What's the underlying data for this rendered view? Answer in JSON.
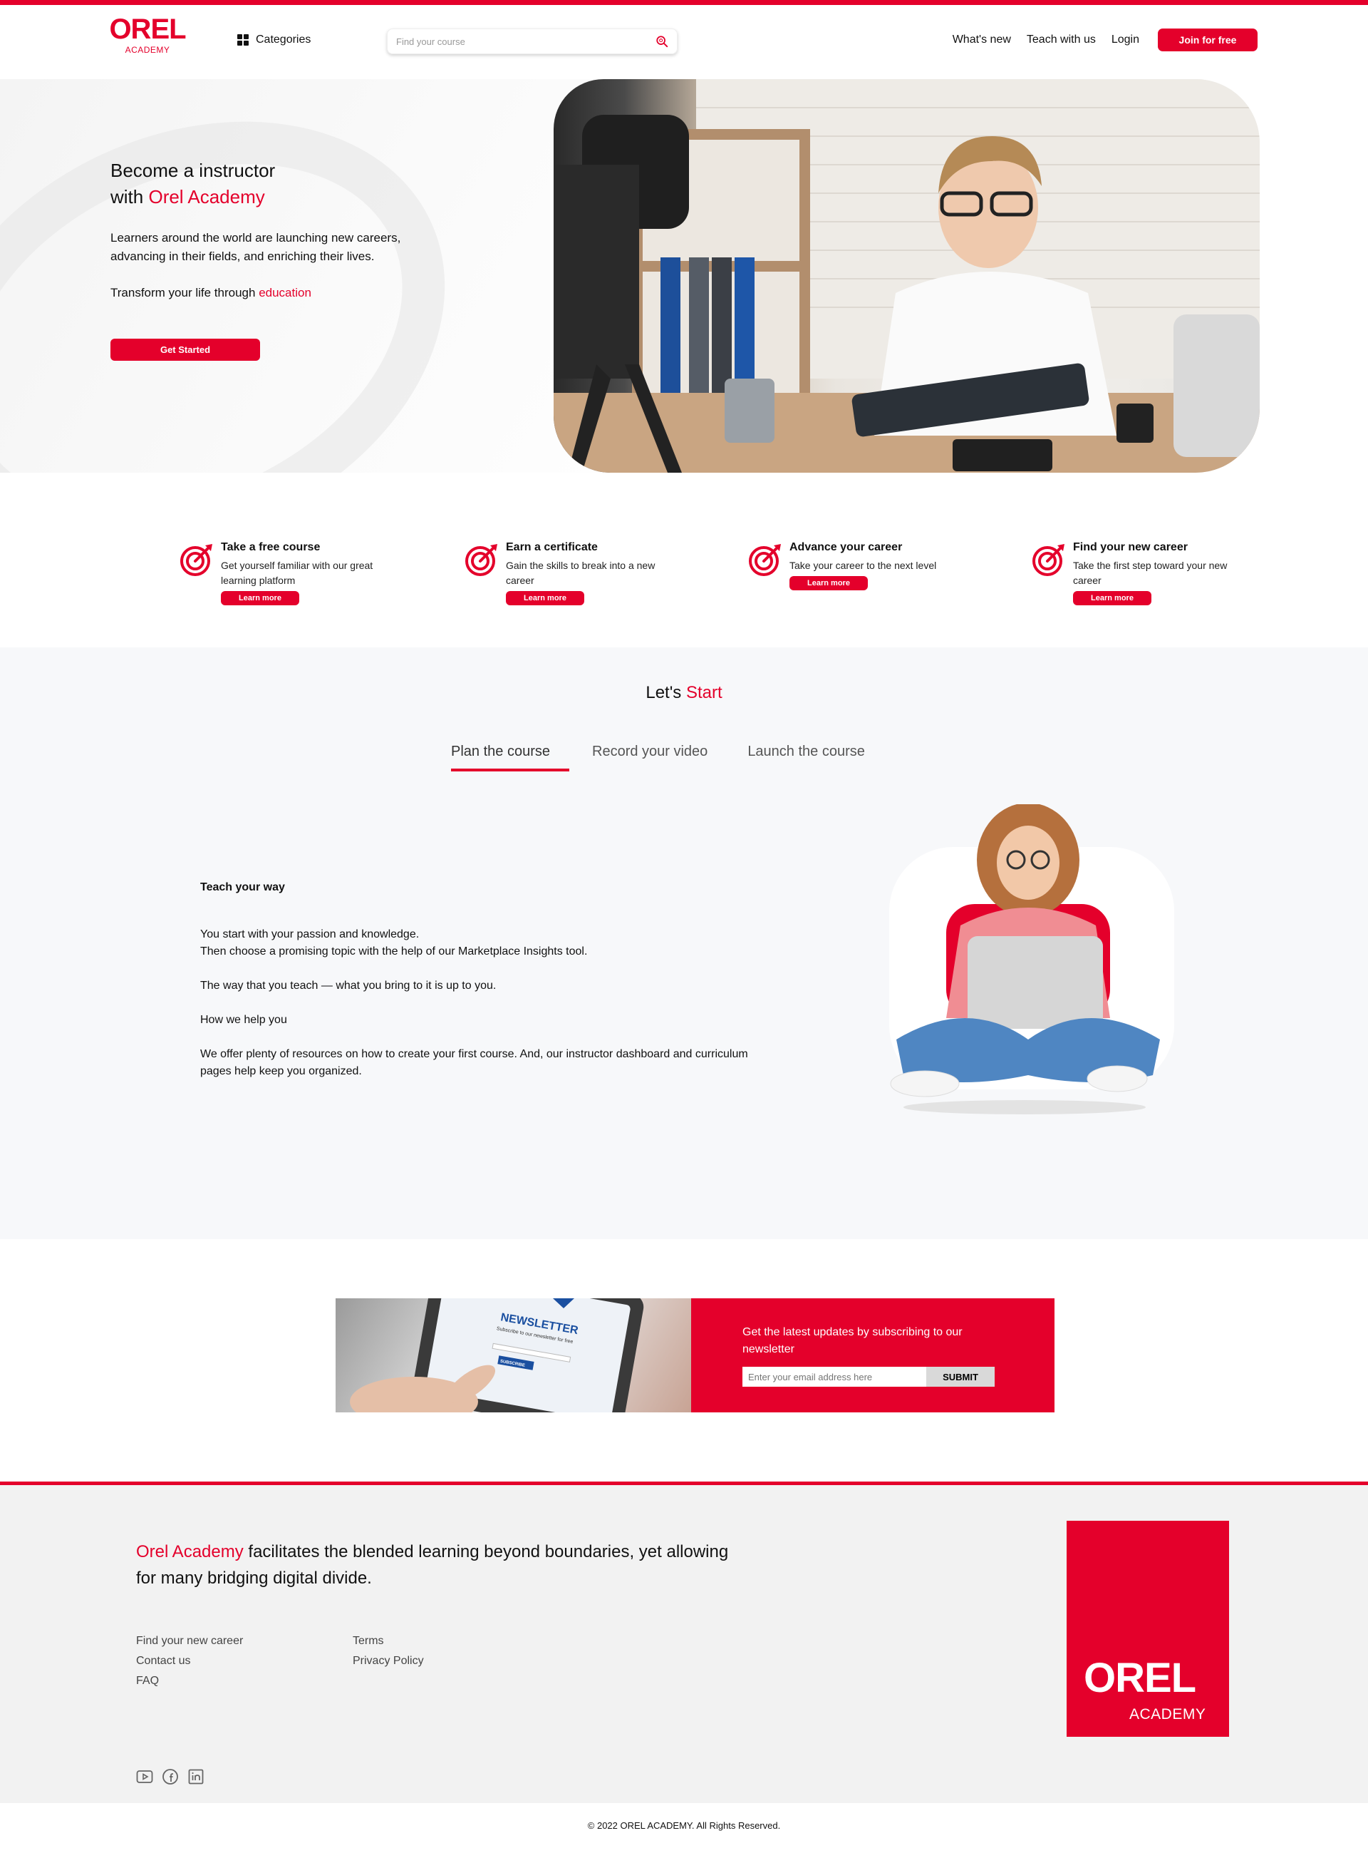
{
  "brand": {
    "logo_main": "OREL",
    "logo_sub": "ACADEMY",
    "accent_color": "#e4002b"
  },
  "header": {
    "categories_label": "Categories",
    "search_placeholder": "Find your course",
    "nav": {
      "whats_new": "What's new",
      "teach": "Teach with us",
      "login": "Login",
      "join": "Join for free"
    }
  },
  "hero": {
    "title_line1": "Become a instructor",
    "title_line2_prefix": "with ",
    "title_line2_highlight": "Orel Academy",
    "description": "Learners around the world are launching new careers, advancing in their fields, and enriching their lives.",
    "transform_prefix": "Transform your life through ",
    "transform_highlight": "education",
    "cta": "Get Started"
  },
  "features": [
    {
      "title": "Take a free course",
      "desc": "Get yourself familiar with our great learning platform",
      "button": "Learn more",
      "icon": "target-icon"
    },
    {
      "title": "Earn a certificate",
      "desc": "Gain the skills to break into a new career",
      "button": "Learn more",
      "icon": "target-icon"
    },
    {
      "title": "Advance your career",
      "desc": "Take your career to the next level",
      "button": "Learn more",
      "icon": "target-icon"
    },
    {
      "title": "Find your new career",
      "desc": "Take the first step toward your new career",
      "button": "Learn more",
      "icon": "target-icon"
    }
  ],
  "lets_start": {
    "title_prefix": "Let's ",
    "title_highlight": "Start",
    "tabs": [
      {
        "label": "Plan the course",
        "active": true
      },
      {
        "label": "Record your video",
        "active": false
      },
      {
        "label": "Launch the course",
        "active": false
      }
    ],
    "content": {
      "heading": "Teach your way",
      "p1_line1": "You start with your passion and knowledge.",
      "p1_line2": "Then choose a promising topic with the help of our Marketplace Insights tool.",
      "p2": "The way that you teach — what you bring to it is up to you.",
      "p3": "How we help you",
      "p4": "We offer plenty of resources on how to create your first course. And, our instructor dashboard and curriculum pages help keep you organized."
    }
  },
  "newsletter": {
    "image_heading": "NEWSLETTER",
    "image_sub": "Subscribe to our newsletter for free",
    "image_button": "SUBSCRIBE",
    "text": "Get the latest updates by subscribing to our newsletter",
    "input_placeholder": "Enter your email address here",
    "submit": "SUBMIT"
  },
  "footer": {
    "tagline_highlight": "Orel Academy",
    "tagline_rest": " facilitates the blended learning beyond boundaries, yet allowing for many bridging digital divide.",
    "links_col1": [
      "Find your new career",
      "Contact us",
      "FAQ"
    ],
    "links_col2": [
      "Terms",
      "Privacy Policy"
    ],
    "logo_main": "OREL",
    "logo_sub": "ACADEMY",
    "socials": [
      "youtube-icon",
      "facebook-icon",
      "linkedin-icon"
    ],
    "copyright": "© 2022 OREL ACADEMY. All Rights Reserved."
  }
}
